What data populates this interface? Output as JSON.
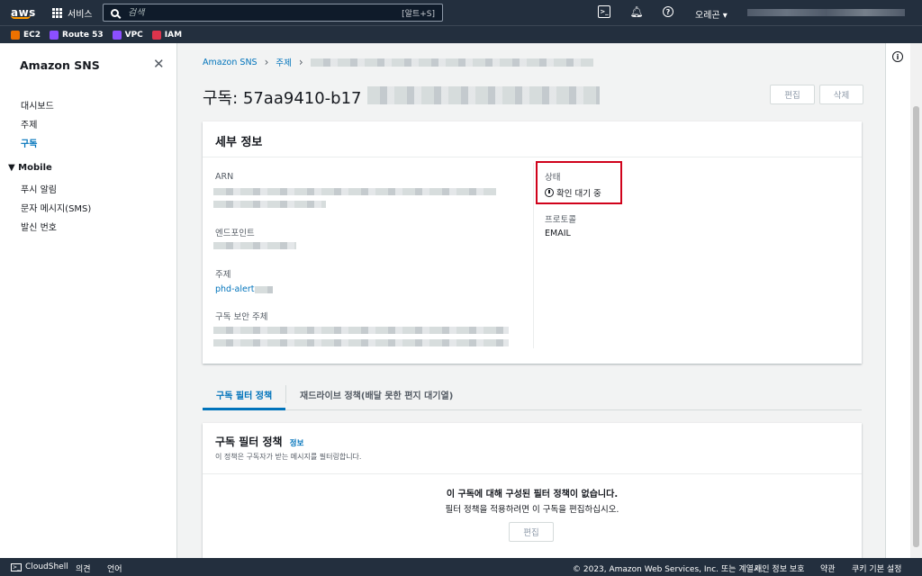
{
  "topbar": {
    "logo": "aws",
    "services_label": "서비스",
    "search_placeholder": "검색",
    "search_shortcut": "[알트+S]",
    "region": "오레곤 ▾"
  },
  "favorites": [
    {
      "label": "EC2",
      "color": "#ed7100"
    },
    {
      "label": "Route 53",
      "color": "#8c4fff"
    },
    {
      "label": "VPC",
      "color": "#8c4fff"
    },
    {
      "label": "IAM",
      "color": "#dd344c"
    }
  ],
  "sidebar": {
    "title": "Amazon SNS",
    "items": [
      "대시보드",
      "주제",
      "구독"
    ],
    "active_item": "구독",
    "section": "▼ Mobile",
    "mobile_items": [
      "푸시 알림",
      "문자 메시지(SMS)",
      "발신 번호"
    ]
  },
  "breadcrumb": {
    "root": "Amazon SNS",
    "topics": "주제"
  },
  "page": {
    "title": "구독: 57aa9410-b17",
    "edit_button": "편집",
    "delete_button": "삭제"
  },
  "details": {
    "header": "세부 정보",
    "arn_label": "ARN",
    "endpoint_label": "엔드포인트",
    "topic_label": "주제",
    "topic_value": "phd-alert",
    "principal_label": "구독 보안 주체",
    "status_label": "상태",
    "status_value": "확인 대기 중",
    "protocol_label": "프로토콜",
    "protocol_value": "EMAIL"
  },
  "tabs": {
    "filter_policy": "구독 필터 정책",
    "redrive_policy": "재드라이브 정책(배달 못한 편지 대기열)"
  },
  "filter_panel": {
    "title": "구독 필터 정책",
    "info_link": "정보",
    "description": "이 정책은 구독자가 받는 메시지를 필터링합니다.",
    "empty_title": "이 구독에 대해 구성된 필터 정책이 없습니다.",
    "empty_desc": "필터 정책을 적용하려면 이 구독을 편집하십시오.",
    "edit_button": "편집"
  },
  "footer": {
    "cloudshell": "CloudShell",
    "feedback": "의견",
    "language": "언어",
    "copyright": "© 2023, Amazon Web Services, Inc. 또는 계열사.",
    "privacy": "개인 정보 보호",
    "terms": "약관",
    "cookies": "쿠키 기본 설정"
  },
  "colors": {
    "nav_bg": "#232f3e",
    "link": "#0073bb",
    "highlight_box": "#d0021b",
    "accent": "#ff9900"
  }
}
